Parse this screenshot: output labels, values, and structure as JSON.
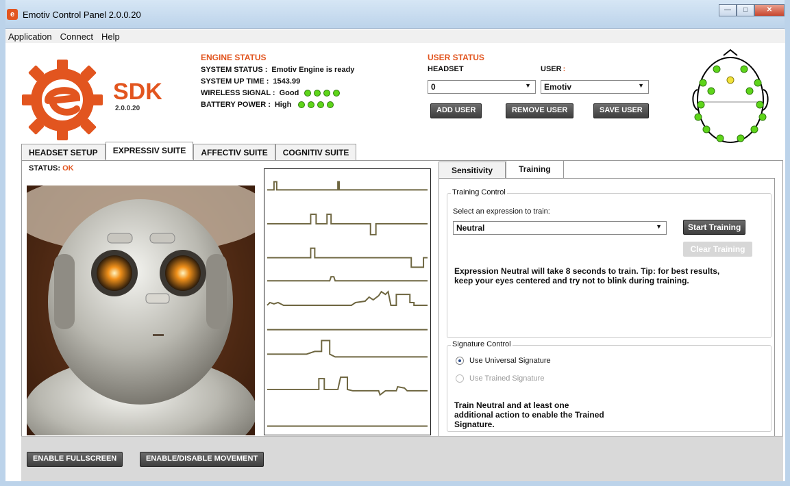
{
  "window": {
    "title": "Emotiv Control Panel 2.0.0.20"
  },
  "menu": [
    "Application",
    "Connect",
    "Help"
  ],
  "logo": {
    "sdk": "SDK",
    "version": "2.0.0.20"
  },
  "engine": {
    "title": "ENGINE STATUS",
    "rows": [
      {
        "key": "SYSTEM STATUS :",
        "value": "Emotiv Engine is ready"
      },
      {
        "key": "SYSTEM UP TIME :",
        "value": "1543.99"
      },
      {
        "key": "WIRELESS SIGNAL :",
        "value": "Good"
      },
      {
        "key": "BATTERY POWER :",
        "value": "High"
      }
    ]
  },
  "user_status": {
    "title": "USER STATUS",
    "headset_label": "HEADSET",
    "user_label": "USER",
    "user_colon": ":",
    "headset_value": "0",
    "user_value": "Emotiv",
    "add_user": "ADD USER",
    "remove_user": "REMOVE USER",
    "save_user": "SAVE USER"
  },
  "tabs": [
    "HEADSET SETUP",
    "EXPRESSIV SUITE",
    "AFFECTIV SUITE",
    "COGNITIV SUITE"
  ],
  "status": {
    "label": "STATUS:",
    "value": "OK"
  },
  "subtabs": [
    "Sensitivity",
    "Training"
  ],
  "training": {
    "group_title": "Training Control",
    "select_label": "Select an expression to train:",
    "expression": "Neutral",
    "start_button": "Start Training",
    "clear_button": "Clear Training",
    "tip": "Expression Neutral will take 8 seconds to train. Tip: for best results, keep your eyes centered and try not to blink during training."
  },
  "signature": {
    "group_title": "Signature Control",
    "universal": "Use Universal Signature",
    "trained": "Use Trained Signature",
    "note": "Train Neutral and at least one additional action to enable the Trained Signature."
  },
  "bottom": {
    "fullscreen": "ENABLE FULLSCREEN",
    "movement": "ENABLE/DISABLE MOVEMENT"
  },
  "colors": {
    "accent": "#e2551f",
    "signal_good": "#5ed51a",
    "sensor_warn": "#f2e23a",
    "trace": "#6e6640"
  }
}
